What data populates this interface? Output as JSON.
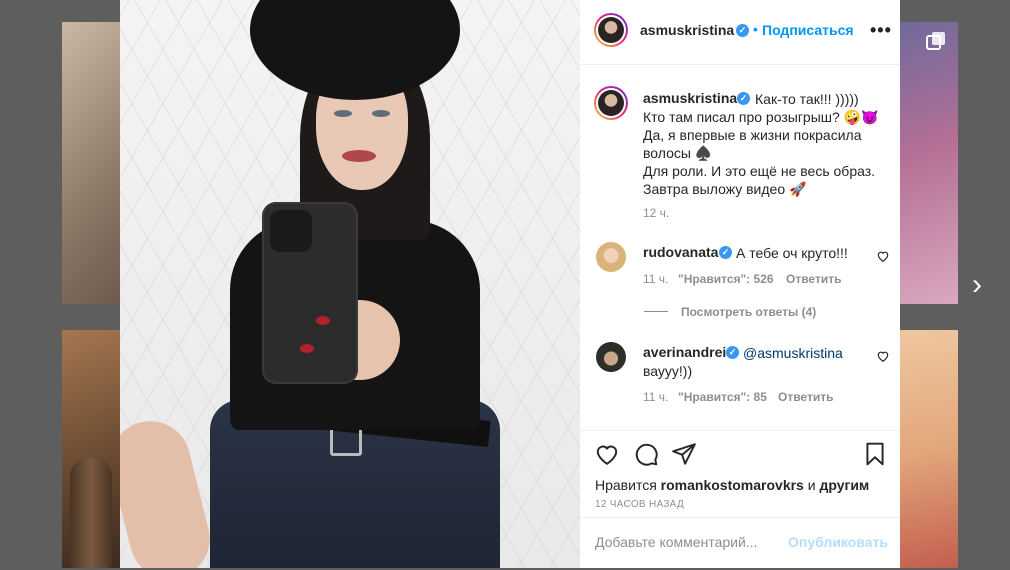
{
  "post": {
    "username": "asmuskristina",
    "follow_label": "Подписаться",
    "dot": "•",
    "more_label": "•••",
    "caption_author": "asmuskristina",
    "caption_first": "Как-то так!!! )))))",
    "caption_rest": "Кто там писал про розыгрыш? 🤪😈\nДа, я впервые в жизни покрасила волосы ♠️\nДля роли. И это ещё не весь образ.\nЗавтра выложу видео 🚀",
    "caption_time": "12 ч."
  },
  "comments": [
    {
      "username": "rudovanata",
      "text": "А тебе оч круто!!!",
      "time": "11 ч.",
      "likes": "\"Нравится\": 526",
      "reply_label": "Ответить",
      "view_replies": "Посмотреть ответы (4)"
    },
    {
      "username": "averinandrei",
      "mention": "@asmuskristina",
      "text": "вауyy!))",
      "time": "11 ч.",
      "likes": "\"Нравится\": 85",
      "reply_label": "Ответить"
    }
  ],
  "footer": {
    "likes_prefix": "Нравится",
    "likes_user": "romankostomarovkrs",
    "likes_and": "и",
    "likes_others": "другим",
    "time_ago": "12 ЧАСОВ НАЗАД",
    "comment_placeholder": "Добавьте комментарий...",
    "publish_label": "Опубликовать"
  },
  "nav": {
    "next_arrow": "›"
  },
  "colors": {
    "accent": "#0095f6",
    "verified": "#3897f0",
    "text": "#262626",
    "muted": "#8e8e8e",
    "publish_disabled": "#b2dffc"
  },
  "icons": [
    "heart-icon",
    "comment-icon",
    "share-icon",
    "bookmark-icon",
    "verified-icon",
    "next-arrow-icon",
    "more-options-icon",
    "carousel-icon"
  ]
}
